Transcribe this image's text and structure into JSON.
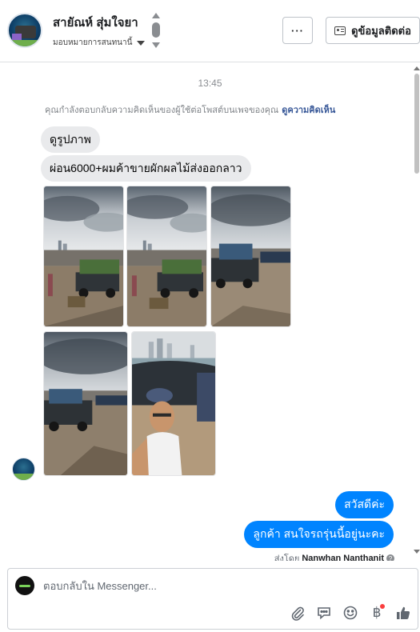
{
  "header": {
    "contact_name": "สายัณห์ สุ่มใจยา",
    "assigned_label": "มอบหมายการสนทนานี้",
    "more_label": "···",
    "contact_info_label": "ดูข้อมูลติดต่อ"
  },
  "conversation": {
    "timestamp": "13:45",
    "notice_text": "คุณกำลังตอบกลับความคิดเห็นของผู้ใช้ต่อโพสต์บนเพจของคุณ",
    "notice_link": "ดูความคิดเห็น",
    "incoming": [
      {
        "text": "ดูรูปภาพ"
      },
      {
        "text": "ผ่อน6000+ผมค้าขายผักผลไม้ส่งออกลาว"
      }
    ],
    "photos": [
      {
        "name": "riverbank-truck-photo-1"
      },
      {
        "name": "riverbank-truck-photo-2"
      },
      {
        "name": "riverbank-truck-photo-3"
      },
      {
        "name": "riverbank-truck-photo-4"
      },
      {
        "name": "selfie-photo"
      }
    ],
    "outgoing": [
      {
        "text": "สวัสดีค่ะ"
      },
      {
        "text": "ลูกค้า สนใจรถรุ่นนี้อยู่นะคะ"
      }
    ],
    "sent_by_label": "ส่งโดย",
    "sent_by_name": "Nanwhan Nanthanit"
  },
  "composer": {
    "placeholder": "ตอบกลับใน Messenger...",
    "icons": [
      "paperclip-icon",
      "saved-reply-icon",
      "emoji-icon",
      "baht-payment-icon",
      "thumbs-up-icon"
    ],
    "baht_symbol": "฿"
  },
  "colors": {
    "outgoing_bubble": "#0084ff",
    "incoming_bubble": "#e9eaec",
    "link": "#385898",
    "notification_dot": "#fa3e3e"
  }
}
